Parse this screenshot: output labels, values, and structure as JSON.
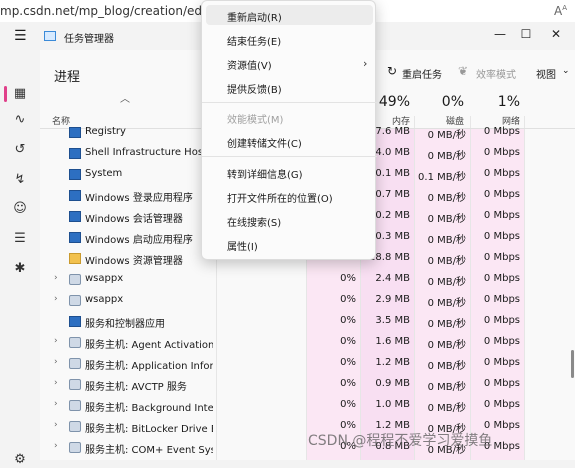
{
  "browser": {
    "url": "mp.csdn.net/mp_blog/creation/editor?spm",
    "font_icon": "A",
    "font_icon_sup": "A"
  },
  "window": {
    "title": "任务管理器",
    "controls": {
      "minimize": "—",
      "maximize": "☐",
      "close": "✕"
    }
  },
  "nav": {
    "icons": [
      "hamburger-icon",
      "processes-icon",
      "performance-icon",
      "app-history-icon",
      "startup-apps-icon",
      "users-icon",
      "details-icon",
      "services-icon",
      "settings-icon"
    ]
  },
  "toolbar": {
    "page_title": "进程",
    "restart_label": "重启任务",
    "efficiency_label": "效率模式",
    "view_label": "视图",
    "view_caret": "⌄"
  },
  "table": {
    "name_header": "名称",
    "memory": {
      "pct": "49%",
      "label": "内存"
    },
    "disk": {
      "pct": "0%",
      "label": "磁盘"
    },
    "network": {
      "pct": "1%",
      "label": "网络"
    },
    "rows": [
      {
        "name": "Registry",
        "cpu": "",
        "mem": "7.6 MB",
        "disk": "0 MB/秒",
        "net": "0 Mbps",
        "icon": "app"
      },
      {
        "name": "Shell Infrastructure Host",
        "cpu": "",
        "mem": "4.0 MB",
        "disk": "0 MB/秒",
        "net": "0 Mbps",
        "icon": "app"
      },
      {
        "name": "System",
        "cpu": "",
        "mem": "0.1 MB",
        "disk": "0.1 MB/秒",
        "net": "0 Mbps",
        "icon": "app"
      },
      {
        "name": "Windows 登录应用程序",
        "cpu": "",
        "mem": "0.7 MB",
        "disk": "0 MB/秒",
        "net": "0 Mbps",
        "icon": "app"
      },
      {
        "name": "Windows 会话管理器",
        "cpu": "",
        "mem": "0.2 MB",
        "disk": "0 MB/秒",
        "net": "0 Mbps",
        "icon": "app"
      },
      {
        "name": "Windows 启动应用程序",
        "cpu": "",
        "mem": "0.3 MB",
        "disk": "0 MB/秒",
        "net": "0 Mbps",
        "icon": "app"
      },
      {
        "name": "Windows 资源管理器",
        "cpu": "0%",
        "mem": "28.8 MB",
        "disk": "0 MB/秒",
        "net": "0 Mbps",
        "icon": "folder"
      },
      {
        "name": "wsappx",
        "cpu": "0%",
        "mem": "2.4 MB",
        "disk": "0 MB/秒",
        "net": "0 Mbps",
        "icon": "gear",
        "expand": "›"
      },
      {
        "name": "wsappx",
        "cpu": "0%",
        "mem": "2.9 MB",
        "disk": "0 MB/秒",
        "net": "0 Mbps",
        "icon": "gear",
        "expand": "›"
      },
      {
        "name": "服务和控制器应用",
        "cpu": "0%",
        "mem": "3.5 MB",
        "disk": "0 MB/秒",
        "net": "0 Mbps",
        "icon": "app"
      },
      {
        "name": "服务主机: Agent Activation ...",
        "cpu": "0%",
        "mem": "1.6 MB",
        "disk": "0 MB/秒",
        "net": "0 Mbps",
        "icon": "gear",
        "expand": "›"
      },
      {
        "name": "服务主机: Application Infor...",
        "cpu": "0%",
        "mem": "1.2 MB",
        "disk": "0 MB/秒",
        "net": "0 Mbps",
        "icon": "gear",
        "expand": "›"
      },
      {
        "name": "服务主机: AVCTP 服务",
        "cpu": "0%",
        "mem": "0.9 MB",
        "disk": "0 MB/秒",
        "net": "0 Mbps",
        "icon": "gear",
        "expand": "›"
      },
      {
        "name": "服务主机: Background Intelli...",
        "cpu": "0%",
        "mem": "1.0 MB",
        "disk": "0 MB/秒",
        "net": "0 Mbps",
        "icon": "gear",
        "expand": "›"
      },
      {
        "name": "服务主机: BitLocker Drive En...",
        "cpu": "0%",
        "mem": "1.2 MB",
        "disk": "0 MB/秒",
        "net": "0 Mbps",
        "icon": "gear",
        "expand": "›"
      },
      {
        "name": "服务主机: COM+ Event Syste...",
        "cpu": "0%",
        "mem": "0.8 MB",
        "disk": "0 MB/秒",
        "net": "0 Mbps",
        "icon": "gear",
        "expand": "›"
      }
    ]
  },
  "context_menu": {
    "items": [
      {
        "label": "重新启动(R)",
        "disabled": false
      },
      {
        "label": "结束任务(E)",
        "disabled": false
      },
      {
        "label": "资源值(V)",
        "disabled": false,
        "submenu": "›"
      },
      {
        "label": "提供反馈(B)",
        "disabled": false
      },
      {
        "label": "效能模式(M)",
        "disabled": true
      },
      {
        "label": "创建转储文件(C)",
        "disabled": false
      },
      {
        "label": "转到详细信息(G)",
        "disabled": false
      },
      {
        "label": "打开文件所在的位置(O)",
        "disabled": false
      },
      {
        "label": "在线搜索(S)",
        "disabled": false
      },
      {
        "label": "属性(I)",
        "disabled": false
      }
    ]
  },
  "watermark": "CSDN @程程不爱学习爱摸鱼"
}
